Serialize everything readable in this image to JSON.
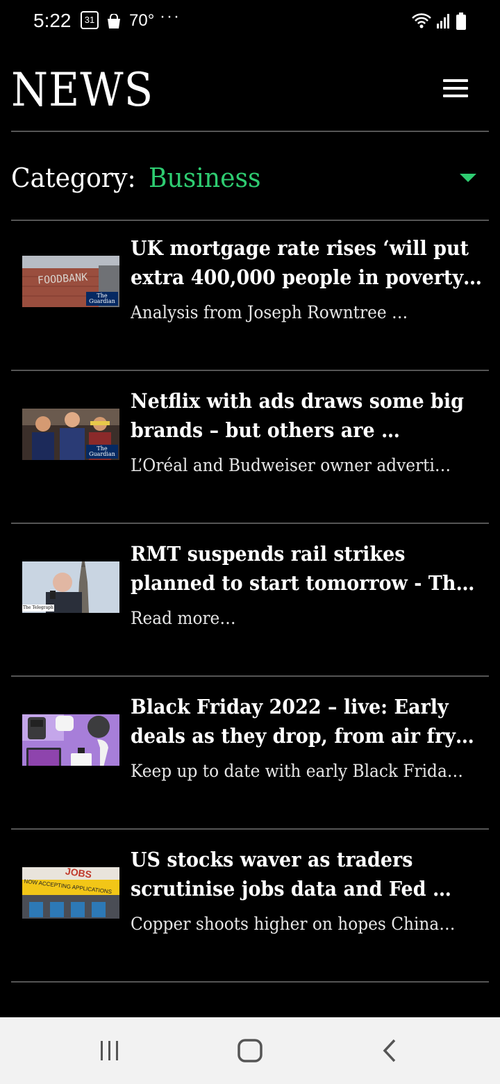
{
  "status_bar": {
    "time": "5:22",
    "calendar_day": "31",
    "temperature": "70°",
    "more": "···",
    "icons": [
      "calendar-icon",
      "shopping-bag-icon",
      "wifi-icon",
      "signal-icon",
      "battery-icon"
    ]
  },
  "header": {
    "title": "NEWS",
    "menu_icon": "hamburger-menu-icon"
  },
  "category": {
    "label": "Category:",
    "value": "Business",
    "accent_color": "#2ecc71"
  },
  "articles": [
    {
      "headline_line1": "UK mortgage rate rises ‘will put",
      "headline_line2": "extra 400,000 people in poverty…",
      "snippet": "Analysis from Joseph Rowntree …",
      "thumb_caption": "FOODBANK",
      "source_badge": "The Guardian"
    },
    {
      "headline_line1": "Netflix with ads draws some big",
      "headline_line2": "brands – but others are …",
      "snippet": "L’Oréal and Budweiser owner adverti…",
      "thumb_caption": "",
      "source_badge": "The Guardian"
    },
    {
      "headline_line1": "RMT suspends rail strikes",
      "headline_line2": "planned to start tomorrow - Th…",
      "snippet": "Read more…",
      "thumb_caption": "",
      "source_badge": "The Telegraph"
    },
    {
      "headline_line1": "Black Friday 2022 – live: Early",
      "headline_line2": "deals as they drop, from air frye…",
      "snippet": "Keep up to date with early Black Frida…",
      "thumb_caption": "",
      "source_badge": ""
    },
    {
      "headline_line1": "US stocks waver as traders",
      "headline_line2": "scrutinise jobs data and Fed …",
      "snippet": "Copper shoots higher on hopes China…",
      "thumb_caption": "JOBS",
      "source_badge": "NOW ACCEPTING APPLICATIONS"
    }
  ],
  "nav_bar": {
    "buttons": [
      "recent-apps-icon",
      "home-icon",
      "back-icon"
    ]
  }
}
